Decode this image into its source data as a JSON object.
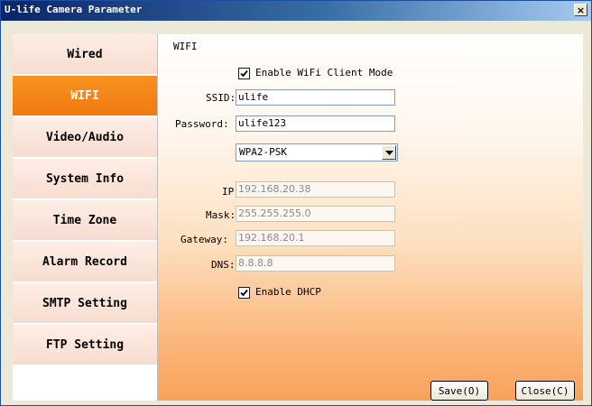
{
  "window": {
    "title": "U-life Camera Parameter",
    "close_glyph": "×"
  },
  "sidebar": {
    "items": [
      {
        "label": "Wired"
      },
      {
        "label": "WIFI"
      },
      {
        "label": "Video/Audio"
      },
      {
        "label": "System Info"
      },
      {
        "label": "Time Zone"
      },
      {
        "label": "Alarm Record"
      },
      {
        "label": "SMTP Setting"
      },
      {
        "label": "FTP Setting"
      }
    ],
    "active": "WIFI"
  },
  "wifi": {
    "section_title": "WIFI",
    "enable_client_label": "Enable WiFi Client Mode",
    "enable_client_checked": true,
    "ssid_label": "SSID:",
    "ssid_value": "ulife",
    "password_label": "Password:",
    "password_value": "ulife123",
    "security_value": "WPA2-PSK",
    "ip_label": "IP:",
    "ip_value": "192.168.20.38",
    "mask_label": "Mask:",
    "mask_value": "255.255.255.0",
    "gateway_label": "Gateway:",
    "gateway_value": "192.168.20.1",
    "dns_label": "DNS:",
    "dns_value": "8.8.8.8",
    "dhcp_label": "Enable DHCP",
    "dhcp_checked": true
  },
  "buttons": {
    "save": "Save(O)",
    "close": "Close(C)"
  },
  "colors": {
    "accent": "#f7921e",
    "title_bar": "#0a246a"
  }
}
